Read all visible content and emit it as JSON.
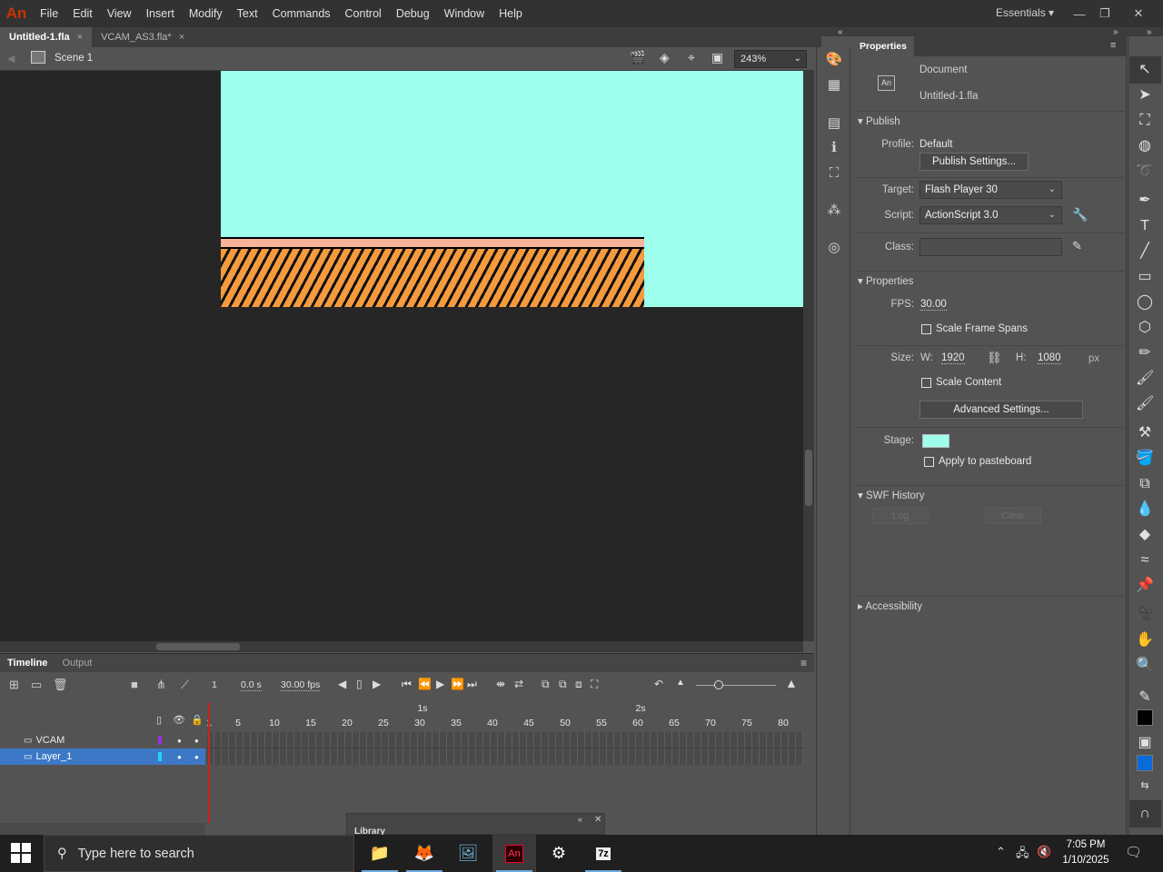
{
  "app": {
    "logo": "An"
  },
  "menu": [
    "File",
    "Edit",
    "View",
    "Insert",
    "Modify",
    "Text",
    "Commands",
    "Control",
    "Debug",
    "Window",
    "Help"
  ],
  "workspace": "Essentials",
  "doc_tabs": [
    {
      "label": "Untitled-1.fla",
      "close": "×"
    },
    {
      "label": "VCAM_AS3.fla*",
      "close": "×"
    }
  ],
  "editbar": {
    "scene": "Scene 1",
    "zoom": "243%"
  },
  "stage_colors": {
    "stage": "#9effec",
    "pasteboard": "#262626",
    "ground_top": "#f7b49a",
    "ground": "#f59a3d"
  },
  "timeline": {
    "tabs": [
      "Timeline",
      "Output"
    ],
    "current_frame": "1",
    "elapsed": "0.0 s",
    "fps": "30.00 fps",
    "seconds": [
      "1s",
      "2s"
    ],
    "ruler": [
      "1",
      "5",
      "10",
      "15",
      "20",
      "25",
      "30",
      "35",
      "40",
      "45",
      "50",
      "55",
      "60",
      "65",
      "70",
      "75",
      "80"
    ],
    "layers": [
      {
        "name": "VCAM",
        "color": "#9b30d9",
        "selected": false
      },
      {
        "name": "Layer_1",
        "color": "#22d4f5",
        "selected": true
      }
    ]
  },
  "library": {
    "title": "Library"
  },
  "properties": {
    "tab": "Properties",
    "doc_type": "Document",
    "doc_name": "Untitled-1.fla",
    "doc_icon": "An",
    "publish": {
      "header": "Publish",
      "profile_label": "Profile:",
      "profile_value": "Default",
      "settings_button": "Publish Settings...",
      "target_label": "Target:",
      "target_value": "Flash Player 30",
      "script_label": "Script:",
      "script_value": "ActionScript 3.0",
      "class_label": "Class:",
      "class_value": ""
    },
    "props": {
      "header": "Properties",
      "fps_label": "FPS:",
      "fps_value": "30.00",
      "scale_frame_spans": "Scale Frame Spans",
      "size_label": "Size:",
      "w_label": "W:",
      "w_value": "1920",
      "h_label": "H:",
      "h_value": "1080",
      "unit": "px",
      "scale_content": "Scale Content",
      "advanced_button": "Advanced Settings...",
      "stage_label": "Stage:",
      "stage_color": "#9effec",
      "apply_pasteboard": "Apply to pasteboard"
    },
    "swf_history": {
      "header": "SWF History",
      "log_button": "Log",
      "clear_button": "Clear"
    },
    "accessibility": {
      "header": "Accessibility"
    }
  },
  "taskbar": {
    "search_placeholder": "Type here to search",
    "time": "7:05 PM",
    "date": "1/10/2025"
  }
}
